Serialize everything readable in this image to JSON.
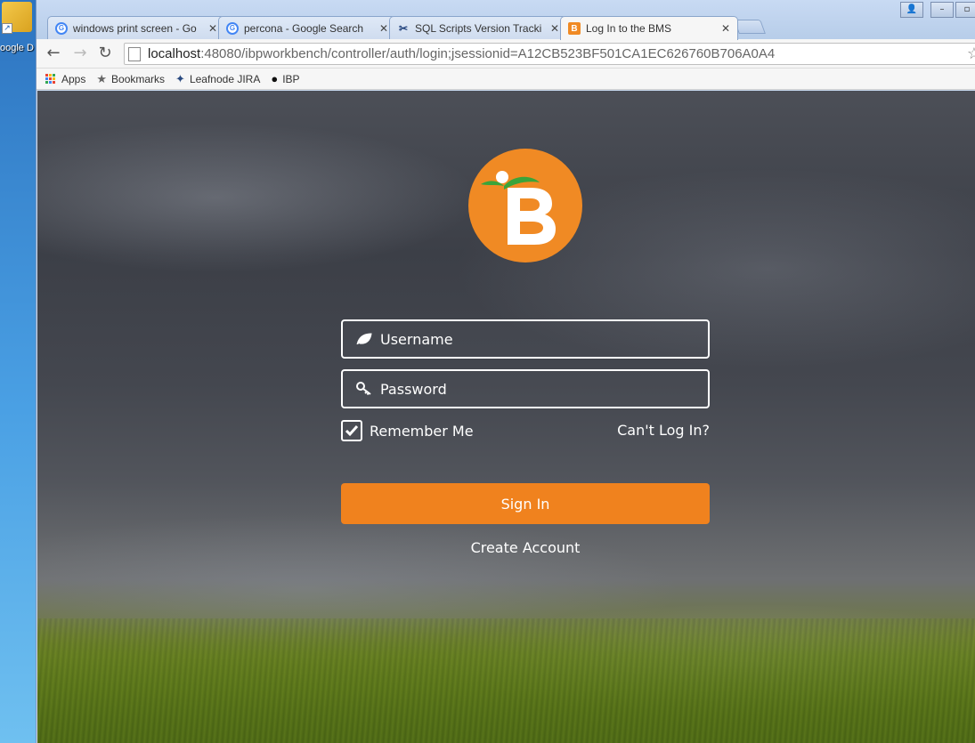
{
  "desktop": {
    "icon_label": "oogle D"
  },
  "tabs": [
    {
      "title": "windows print screen - Go",
      "favicon": "google-icon",
      "active": false
    },
    {
      "title": "percona - Google Search",
      "favicon": "google-icon",
      "active": false
    },
    {
      "title": "SQL Scripts Version Tracki",
      "favicon": "sql-scripts-icon",
      "active": false
    },
    {
      "title": "Log In to the BMS",
      "favicon": "bms-icon",
      "active": true
    }
  ],
  "toolbar": {
    "url_host": "localhost",
    "url_rest": ":48080/ibpworkbench/controller/auth/login;jsessionid=A12CB523BF501CA1EC626760B706A0A4"
  },
  "bookmarks": [
    {
      "label": "Apps",
      "icon": "apps-grid-icon"
    },
    {
      "label": "Bookmarks",
      "icon": "star-icon"
    },
    {
      "label": "Leafnode JIRA",
      "icon": "jira-icon"
    },
    {
      "label": "IBP",
      "icon": "github-icon"
    }
  ],
  "login": {
    "username_placeholder": "Username",
    "password_placeholder": "Password",
    "remember_label": "Remember Me",
    "remember_checked": true,
    "cant_login": "Can't Log In?",
    "signin_label": "Sign In",
    "create_account": "Create Account"
  },
  "colors": {
    "accent": "#f0821e",
    "logo": "#f08a24",
    "leaf": "#3aa43a"
  }
}
